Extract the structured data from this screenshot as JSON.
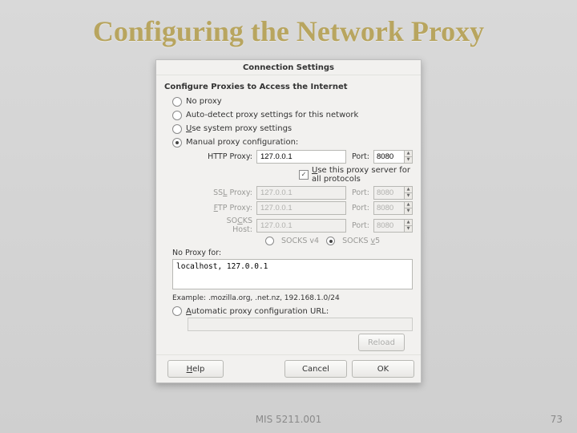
{
  "slide": {
    "title": "Configuring the Network Proxy",
    "course": "MIS 5211.001",
    "page": "73"
  },
  "dialog": {
    "title": "Connection Settings",
    "section": "Configure Proxies to Access the Internet",
    "radios": {
      "none": "No proxy",
      "auto": "Auto-detect proxy settings for this network",
      "system": "Use system proxy settings",
      "manual": "Manual proxy configuration:"
    },
    "labels": {
      "http": "HTTP Proxy:",
      "ssl": "SSL Proxy:",
      "ftp": "FTP Proxy:",
      "socks": "SOCKS Host:",
      "port": "Port:"
    },
    "values": {
      "http_host": "127.0.0.1",
      "http_port": "8080",
      "ssl_host": "127.0.0.1",
      "ssl_port": "8080",
      "ftp_host": "127.0.0.1",
      "ftp_port": "8080",
      "socks_host": "127.0.0.1",
      "socks_port": "8080"
    },
    "use_all": "Use this proxy server for all protocols",
    "socks_v4": "SOCKS v4",
    "socks_v5": "SOCKS v5",
    "noproxy_label": "No Proxy for:",
    "noproxy_val": "localhost, 127.0.0.1",
    "example": "Example: .mozilla.org, .net.nz, 192.168.1.0/24",
    "autocfg": "Automatic proxy configuration URL:",
    "buttons": {
      "reload": "Reload",
      "help": "Help",
      "cancel": "Cancel",
      "ok": "OK"
    }
  }
}
